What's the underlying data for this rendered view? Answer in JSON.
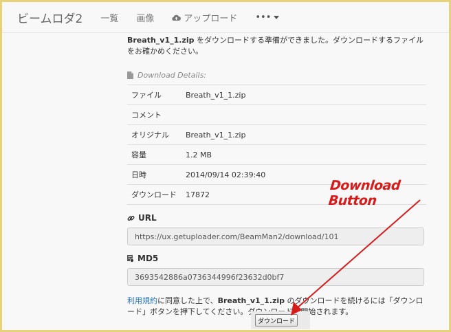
{
  "nav": {
    "brand": "ビームロダ2",
    "items": [
      "一覧",
      "画像",
      "アップロード"
    ],
    "more": "•••"
  },
  "intro": {
    "filename": "Breath_v1_1.zip",
    "text": " をダウンロードする準備ができました。ダウンロードするファイルをお確かめください。"
  },
  "details": {
    "heading": "Download Details:",
    "rows": [
      {
        "label": "ファイル",
        "value": "Breath_v1_1.zip"
      },
      {
        "label": "コメント",
        "value": ""
      },
      {
        "label": "オリジナル",
        "value": "Breath_v1_1.zip"
      },
      {
        "label": "容量",
        "value": "1.2 MB"
      },
      {
        "label": "日時",
        "value": "2014/09/14 02:39:40"
      },
      {
        "label": "ダウンロード",
        "value": "17872"
      }
    ]
  },
  "url": {
    "heading": "URL",
    "value": "https://ux.getuploader.com/BeamMan2/download/101"
  },
  "md5": {
    "heading": "MD5",
    "value": "3693542886a0736344996f23632d0bf7"
  },
  "note": {
    "link": "利用規約",
    "part1": "に同意した上で、",
    "filename": "Breath_v1_1.zip",
    "part2": " のダウンロードを続けるには「ダウンロード」ボタンを押下してください。ダウンロードが開始されます。"
  },
  "download_button": "ダウンロード",
  "annotation": "Download Button",
  "colors": {
    "annotation": "#d61b1b",
    "link": "#2a76c6",
    "frame": "#e6d27a"
  }
}
